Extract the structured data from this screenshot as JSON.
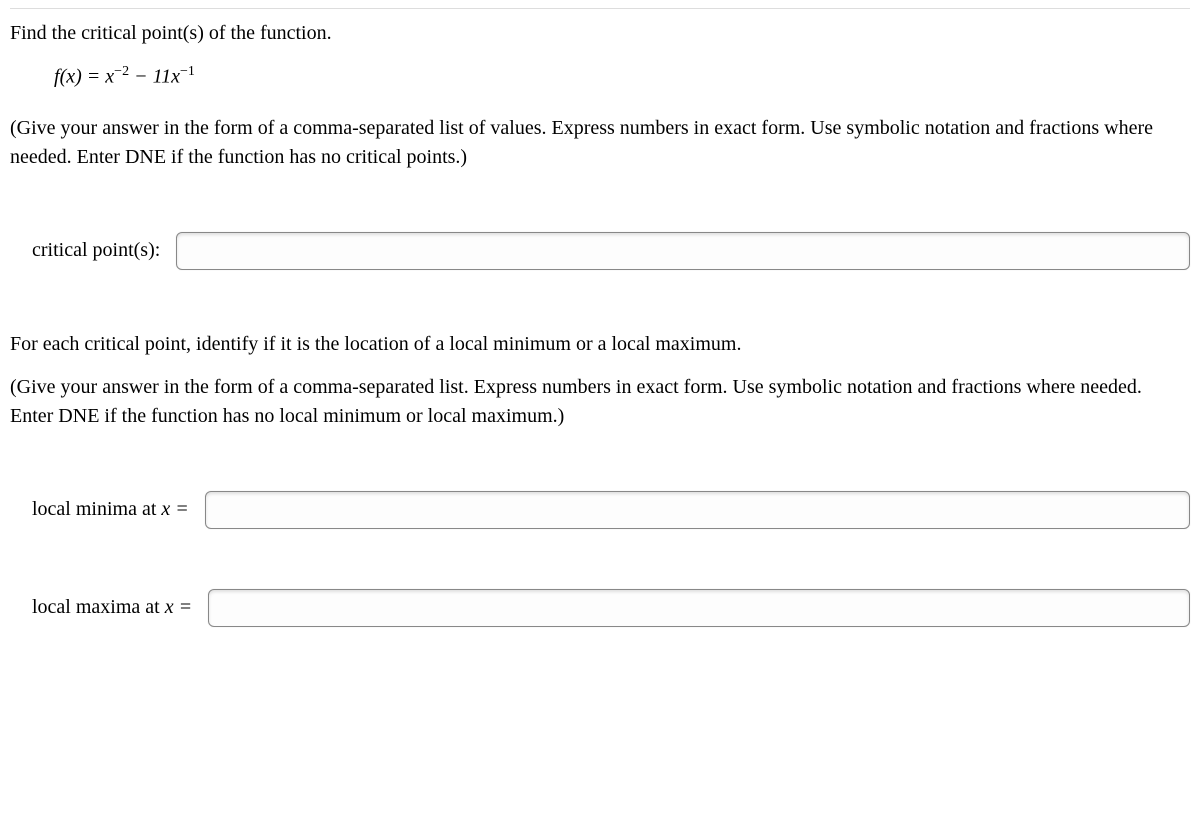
{
  "q1": {
    "prompt": "Find the critical point(s) of the function.",
    "equation_html": "<span class='fn'>f</span>(<span class='fn'>x</span>) = <span class='fn'>x</span><sup>−2</sup> − 11<span class='fn'>x</span><sup>−1</sup>",
    "instructions": "(Give your answer in the form of a comma-separated list of values. Express numbers in exact form. Use symbolic notation and fractions where needed. Enter DNE if the function has no critical points.)",
    "answer_label": "critical point(s):",
    "answer_value": ""
  },
  "q2": {
    "para1": "For each critical point, identify if it is the location of a local minimum or a local maximum.",
    "para2": "(Give your answer in the form of a comma-separated list. Express numbers in exact form. Use symbolic notation and fractions where needed. Enter DNE if the function has no local minimum or local maximum.)",
    "minima_label_prefix": "local minima at ",
    "maxima_label_prefix": "local maxima at ",
    "x_eq": "x =",
    "minima_value": "",
    "maxima_value": ""
  }
}
